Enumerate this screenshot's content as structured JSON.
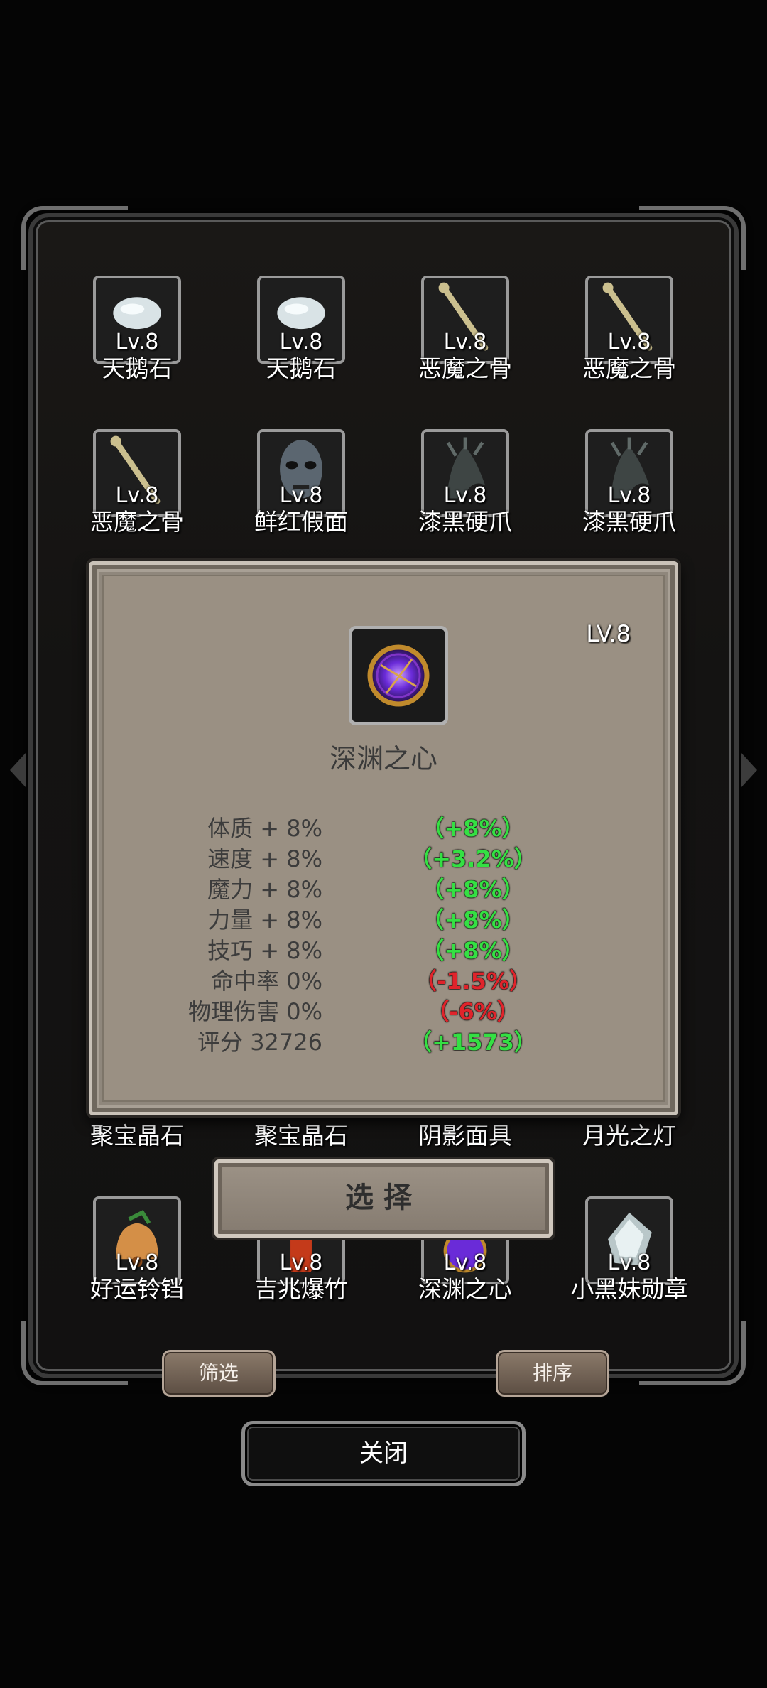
{
  "colors": {
    "panel_bg": "#141312",
    "popup_bg": "#9a9083",
    "positive": "#34e043",
    "negative": "#e0242b"
  },
  "grid": {
    "items": [
      {
        "level": "Lv.8",
        "name": "天鹅石",
        "icon": "white-stone-icon"
      },
      {
        "level": "Lv.8",
        "name": "天鹅石",
        "icon": "white-stone-icon"
      },
      {
        "level": "Lv.8",
        "name": "恶魔之骨",
        "icon": "bone-icon"
      },
      {
        "level": "Lv.8",
        "name": "恶魔之骨",
        "icon": "bone-icon"
      },
      {
        "level": "Lv.8",
        "name": "恶魔之骨",
        "icon": "bone-icon"
      },
      {
        "level": "Lv.8",
        "name": "鲜红假面",
        "icon": "mask-icon"
      },
      {
        "level": "Lv.8",
        "name": "漆黑硬爪",
        "icon": "claw-icon"
      },
      {
        "level": "Lv.8",
        "name": "漆黑硬爪",
        "icon": "claw-icon"
      },
      {
        "level": "",
        "name": "聚宝晶石",
        "icon": "crystal-icon"
      },
      {
        "level": "",
        "name": "聚宝晶石",
        "icon": "crystal-icon"
      },
      {
        "level": "",
        "name": "阴影面具",
        "icon": "shadow-mask-icon"
      },
      {
        "level": "",
        "name": "月光之灯",
        "icon": "lamp-icon"
      },
      {
        "level": "Lv.8",
        "name": "好运铃铛",
        "icon": "bell-icon"
      },
      {
        "level": "Lv.8",
        "name": "吉兆爆竹",
        "icon": "firecracker-icon"
      },
      {
        "level": "Lv.8",
        "name": "深渊之心",
        "icon": "abyss-heart-icon"
      },
      {
        "level": "Lv.8",
        "name": "小黑妹勋章",
        "icon": "medal-icon"
      }
    ]
  },
  "popup": {
    "level": "LV.8",
    "name": "深渊之心",
    "icon": "abyss-heart-icon",
    "stats": [
      {
        "label": "体质 + 8%",
        "delta": "（+8%）",
        "sign": "pos"
      },
      {
        "label": "速度 + 8%",
        "delta": "（+3.2%）",
        "sign": "pos"
      },
      {
        "label": "魔力 + 8%",
        "delta": "（+8%）",
        "sign": "pos"
      },
      {
        "label": "力量 + 8%",
        "delta": "（+8%）",
        "sign": "pos"
      },
      {
        "label": "技巧 + 8%",
        "delta": "（+8%）",
        "sign": "pos"
      },
      {
        "label": "命中率  0%",
        "delta": "（-1.5%）",
        "sign": "neg"
      },
      {
        "label": "物理伤害 0%",
        "delta": "（-6%）",
        "sign": "neg"
      },
      {
        "label": "评分 32726",
        "delta": "（+1573）",
        "sign": "pos"
      }
    ],
    "select_label": "选择"
  },
  "buttons": {
    "filter": "筛选",
    "sort": "排序",
    "close": "关闭"
  }
}
